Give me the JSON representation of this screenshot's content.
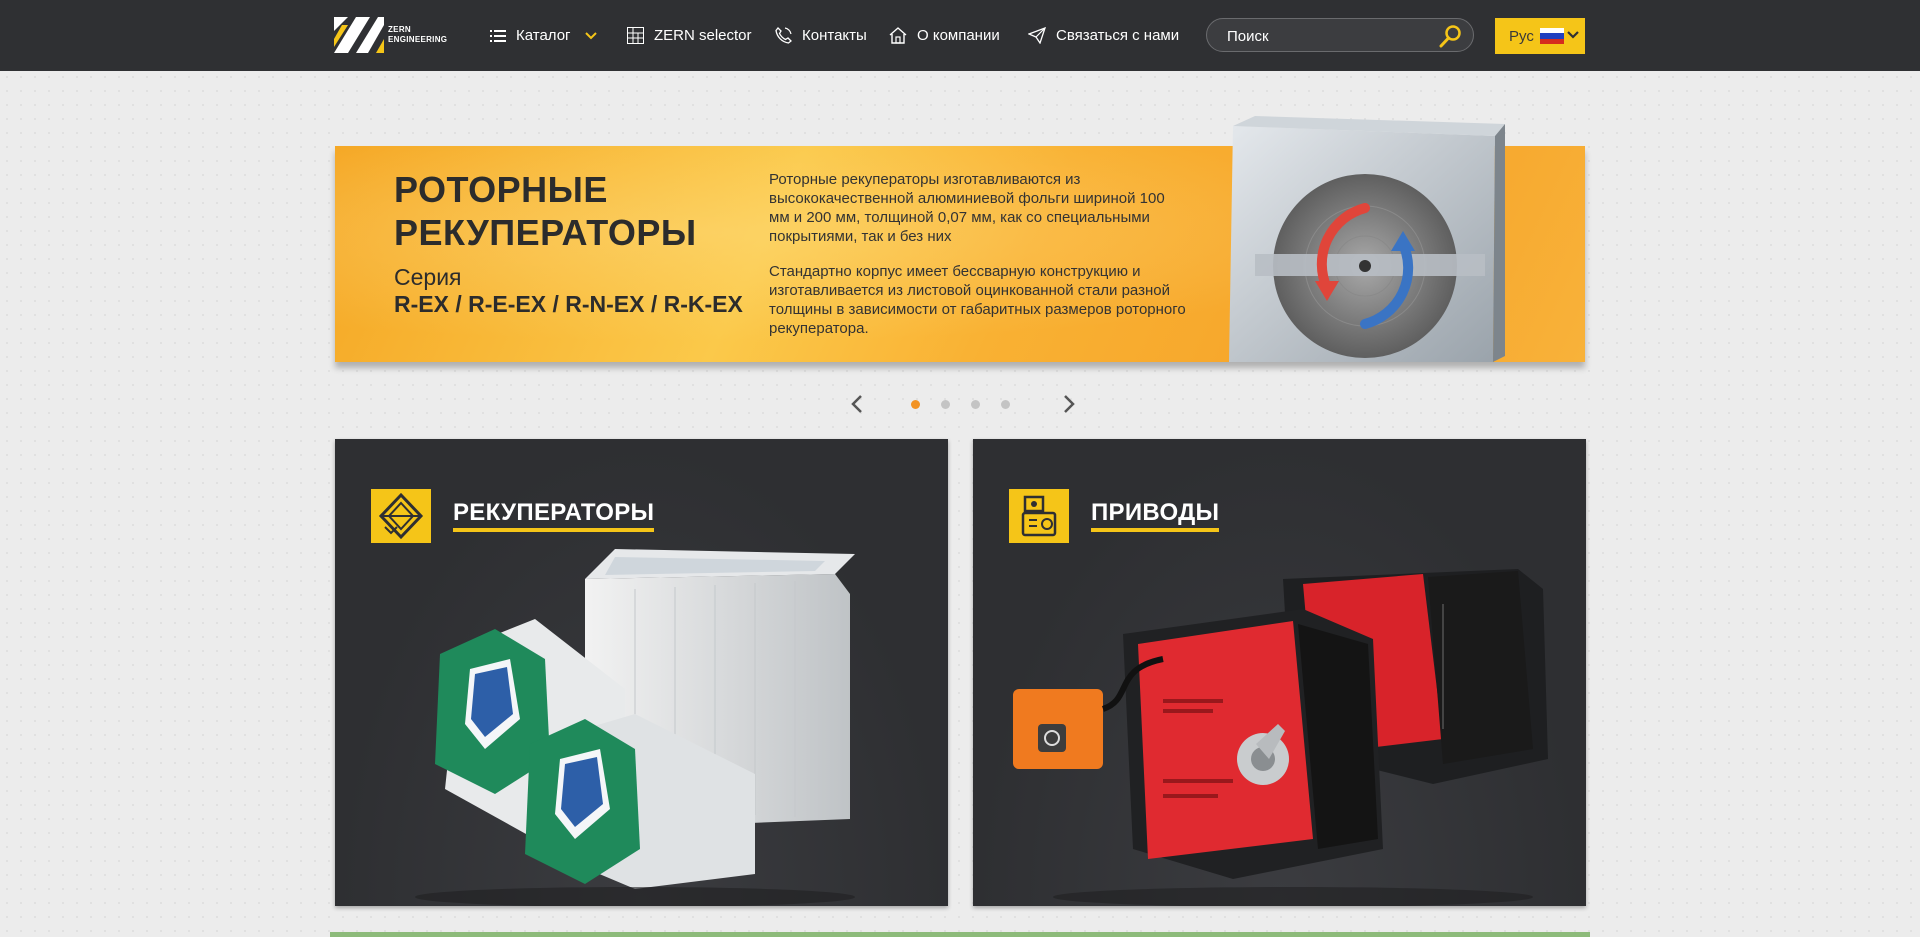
{
  "header": {
    "logo_text_line1": "ZERN",
    "logo_text_line2": "ENGINEERING",
    "nav": {
      "catalog": "Каталог",
      "selector": "ZERN selector",
      "contacts": "Контакты",
      "about": "О компании",
      "contact_us": "Связаться с нами"
    },
    "search_placeholder": "Поиск",
    "language": "Рус"
  },
  "banner": {
    "title": "РОТОРНЫЕ РЕКУПЕРАТОРЫ",
    "series_label": "Серия",
    "series": "R-EX / R-E-EX / R-N-EX / R-K-EX",
    "paragraph1": "Роторные рекуператоры изготавливаются из высококачественной алюминиевой фольги шириной 100 мм и 200 мм, толщиной 0,07 мм, как со специальными покрытиями, так и без них",
    "paragraph2": "Стандартно корпус имеет бессварную конструкцию и изготавливается из листовой оцинкованной стали разной толщины в зависимости от габаритных размеров роторного рекуператора."
  },
  "slider": {
    "slide_count": 4,
    "active_slide": 1
  },
  "cards": [
    {
      "title": "РЕКУПЕРАТОРЫ",
      "icon": "heat-exchanger-icon"
    },
    {
      "title": "ПРИВОДЫ",
      "icon": "actuator-icon"
    }
  ],
  "colors": {
    "header_bg": "#2f3033",
    "accent_yellow": "#f5c518",
    "active_dot": "#f29324",
    "card_bg": "#2e2f32"
  }
}
